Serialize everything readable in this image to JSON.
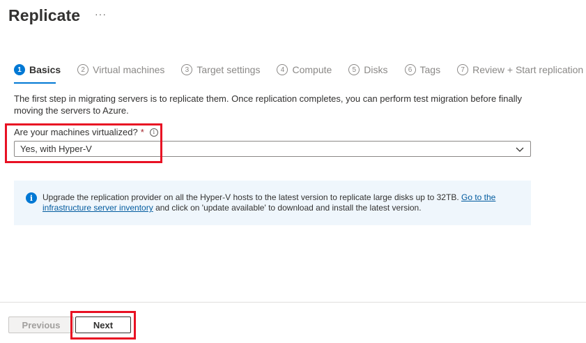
{
  "header": {
    "title": "Replicate",
    "more_label": "···"
  },
  "steps": [
    {
      "num": "1",
      "label": "Basics",
      "active": true
    },
    {
      "num": "2",
      "label": "Virtual machines",
      "active": false
    },
    {
      "num": "3",
      "label": "Target settings",
      "active": false
    },
    {
      "num": "4",
      "label": "Compute",
      "active": false
    },
    {
      "num": "5",
      "label": "Disks",
      "active": false
    },
    {
      "num": "6",
      "label": "Tags",
      "active": false
    },
    {
      "num": "7",
      "label": "Review + Start replication",
      "active": false
    }
  ],
  "description": "The first step in migrating servers is to replicate them. Once replication completes, you can perform test migration before finally moving the servers to Azure.",
  "field": {
    "label": "Are your machines virtualized?",
    "required_mark": "*",
    "info_glyph": "i",
    "value": "Yes, with Hyper-V"
  },
  "banner": {
    "icon_glyph": "i",
    "text_before": "Upgrade the replication provider on all the Hyper-V hosts to the latest version to replicate large disks up to 32TB. ",
    "link_text": "Go to the infrastructure server inventory",
    "text_after": " and click on 'update available' to download and install the latest version."
  },
  "footer": {
    "previous_label": "Previous",
    "next_label": "Next"
  },
  "colors": {
    "accent": "#0078d4",
    "highlight": "#e81123",
    "banner_bg": "#eff6fc",
    "required": "#a4262c"
  }
}
